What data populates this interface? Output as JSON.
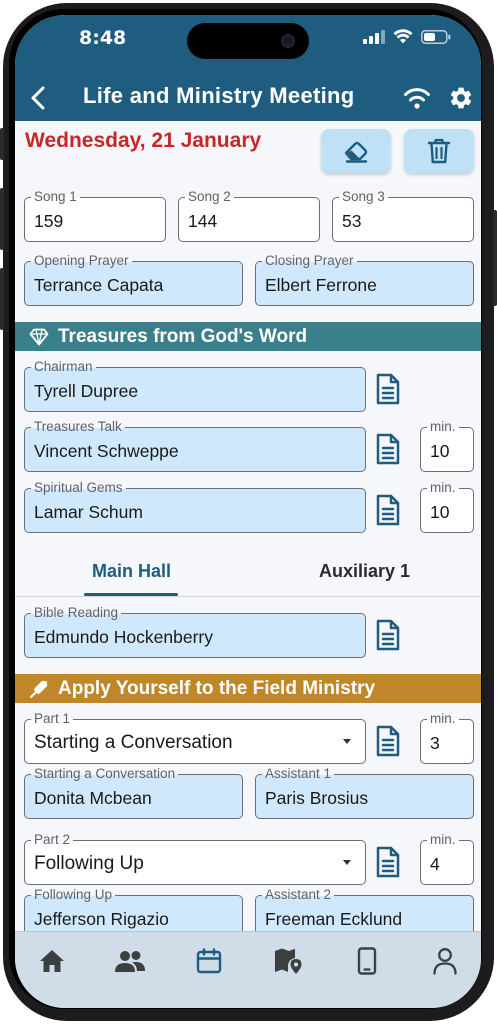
{
  "status": {
    "time": "8:48"
  },
  "app_bar": {
    "title": "Life and Ministry Meeting"
  },
  "meeting": {
    "date": "Wednesday, 21 January"
  },
  "songs": [
    {
      "label": "Song 1",
      "value": "159"
    },
    {
      "label": "Song 2",
      "value": "144"
    },
    {
      "label": "Song 3",
      "value": "53"
    }
  ],
  "prayers": {
    "opening": {
      "label": "Opening Prayer",
      "value": "Terrance Capata"
    },
    "closing": {
      "label": "Closing Prayer",
      "value": "Elbert Ferrone"
    }
  },
  "treasures": {
    "title": "Treasures from God's Word",
    "chairman": {
      "label": "Chairman",
      "value": "Tyrell Dupree"
    },
    "talk": {
      "label": "Treasures Talk",
      "value": "Vincent Schweppe",
      "min_label": "min.",
      "min": "10"
    },
    "gems": {
      "label": "Spiritual Gems",
      "value": "Lamar Schum",
      "min_label": "min.",
      "min": "10"
    }
  },
  "tabs": {
    "main": "Main Hall",
    "aux": "Auxiliary 1"
  },
  "bible_reading": {
    "label": "Bible Reading",
    "value": "Edmundo Hockenberry"
  },
  "apply": {
    "title": "Apply Yourself to the Field Ministry",
    "part1": {
      "label": "Part 1",
      "value": "Starting a Conversation",
      "min_label": "min.",
      "min": "3",
      "student_label": "Starting a Conversation",
      "student": "Donita Mcbean",
      "assistant_label": "Assistant 1",
      "assistant": "Paris Brosius"
    },
    "part2": {
      "label": "Part 2",
      "value": "Following Up",
      "min_label": "min.",
      "min": "4",
      "student_label": "Following Up",
      "student": "Jefferson Rigazio",
      "assistant_label": "Assistant 2",
      "assistant": "Freeman Ecklund"
    }
  },
  "colors": {
    "primary": "#1f5d80",
    "date": "#c62828",
    "treasures": "#3a7f8c",
    "apply": "#c0862a",
    "filled_field": "#cfe8fc"
  },
  "bottom_nav": {
    "items": [
      "home-icon",
      "people-icon",
      "calendar-icon",
      "map-pin-icon",
      "phone-icon",
      "person-icon"
    ]
  }
}
